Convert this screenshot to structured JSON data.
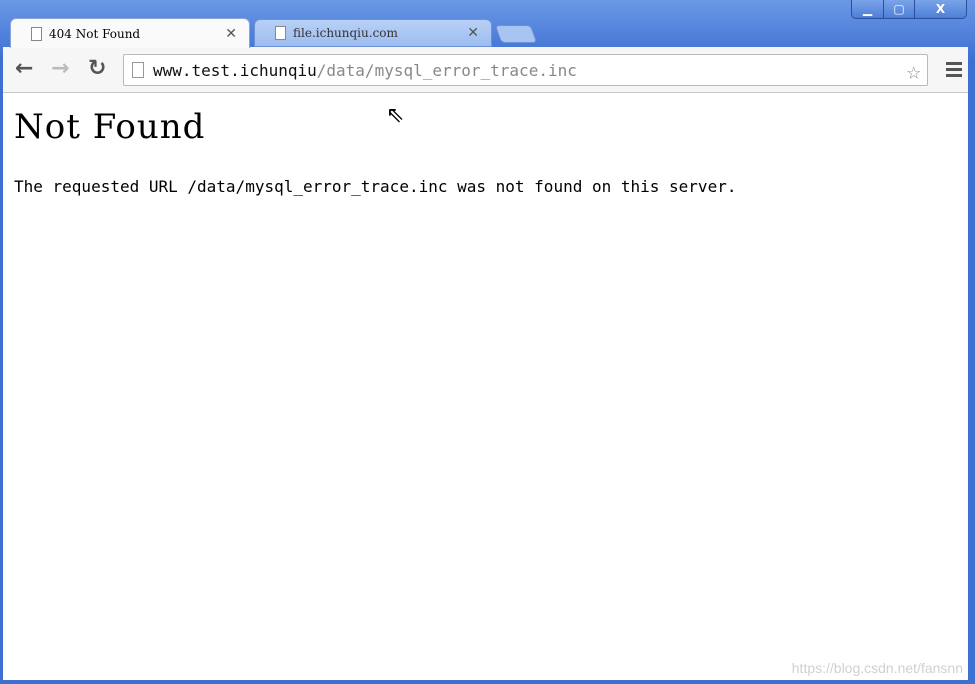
{
  "window": {
    "controls": [
      "minimize",
      "maximize",
      "close"
    ]
  },
  "tabs": [
    {
      "title": "404 Not Found",
      "active": true
    },
    {
      "title": "file.ichunqiu.com",
      "active": false
    }
  ],
  "toolbar": {
    "url_host": "www.test.ichunqiu",
    "url_path": "/data/mysql_error_trace.inc"
  },
  "page": {
    "heading": "Not Found",
    "message": "The requested URL /data/mysql_error_trace.inc was not found on this server."
  },
  "watermark": "https://blog.csdn.net/fansnn"
}
